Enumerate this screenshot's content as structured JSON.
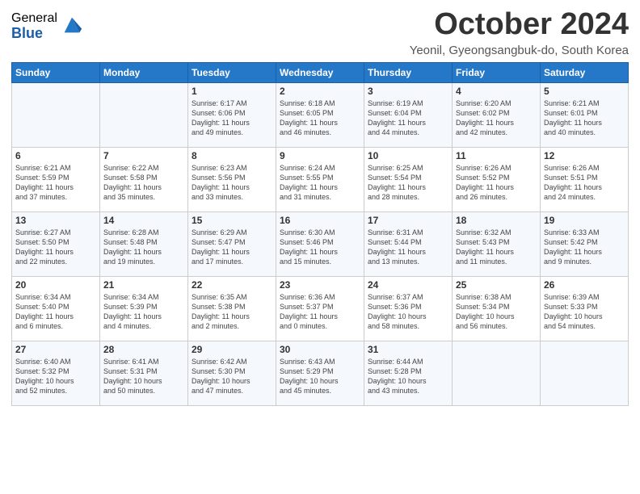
{
  "logo": {
    "general": "General",
    "blue": "Blue"
  },
  "title": "October 2024",
  "subtitle": "Yeonil, Gyeongsangbuk-do, South Korea",
  "days_of_week": [
    "Sunday",
    "Monday",
    "Tuesday",
    "Wednesday",
    "Thursday",
    "Friday",
    "Saturday"
  ],
  "weeks": [
    [
      {
        "num": "",
        "detail": ""
      },
      {
        "num": "",
        "detail": ""
      },
      {
        "num": "1",
        "detail": "Sunrise: 6:17 AM\nSunset: 6:06 PM\nDaylight: 11 hours\nand 49 minutes."
      },
      {
        "num": "2",
        "detail": "Sunrise: 6:18 AM\nSunset: 6:05 PM\nDaylight: 11 hours\nand 46 minutes."
      },
      {
        "num": "3",
        "detail": "Sunrise: 6:19 AM\nSunset: 6:04 PM\nDaylight: 11 hours\nand 44 minutes."
      },
      {
        "num": "4",
        "detail": "Sunrise: 6:20 AM\nSunset: 6:02 PM\nDaylight: 11 hours\nand 42 minutes."
      },
      {
        "num": "5",
        "detail": "Sunrise: 6:21 AM\nSunset: 6:01 PM\nDaylight: 11 hours\nand 40 minutes."
      }
    ],
    [
      {
        "num": "6",
        "detail": "Sunrise: 6:21 AM\nSunset: 5:59 PM\nDaylight: 11 hours\nand 37 minutes."
      },
      {
        "num": "7",
        "detail": "Sunrise: 6:22 AM\nSunset: 5:58 PM\nDaylight: 11 hours\nand 35 minutes."
      },
      {
        "num": "8",
        "detail": "Sunrise: 6:23 AM\nSunset: 5:56 PM\nDaylight: 11 hours\nand 33 minutes."
      },
      {
        "num": "9",
        "detail": "Sunrise: 6:24 AM\nSunset: 5:55 PM\nDaylight: 11 hours\nand 31 minutes."
      },
      {
        "num": "10",
        "detail": "Sunrise: 6:25 AM\nSunset: 5:54 PM\nDaylight: 11 hours\nand 28 minutes."
      },
      {
        "num": "11",
        "detail": "Sunrise: 6:26 AM\nSunset: 5:52 PM\nDaylight: 11 hours\nand 26 minutes."
      },
      {
        "num": "12",
        "detail": "Sunrise: 6:26 AM\nSunset: 5:51 PM\nDaylight: 11 hours\nand 24 minutes."
      }
    ],
    [
      {
        "num": "13",
        "detail": "Sunrise: 6:27 AM\nSunset: 5:50 PM\nDaylight: 11 hours\nand 22 minutes."
      },
      {
        "num": "14",
        "detail": "Sunrise: 6:28 AM\nSunset: 5:48 PM\nDaylight: 11 hours\nand 19 minutes."
      },
      {
        "num": "15",
        "detail": "Sunrise: 6:29 AM\nSunset: 5:47 PM\nDaylight: 11 hours\nand 17 minutes."
      },
      {
        "num": "16",
        "detail": "Sunrise: 6:30 AM\nSunset: 5:46 PM\nDaylight: 11 hours\nand 15 minutes."
      },
      {
        "num": "17",
        "detail": "Sunrise: 6:31 AM\nSunset: 5:44 PM\nDaylight: 11 hours\nand 13 minutes."
      },
      {
        "num": "18",
        "detail": "Sunrise: 6:32 AM\nSunset: 5:43 PM\nDaylight: 11 hours\nand 11 minutes."
      },
      {
        "num": "19",
        "detail": "Sunrise: 6:33 AM\nSunset: 5:42 PM\nDaylight: 11 hours\nand 9 minutes."
      }
    ],
    [
      {
        "num": "20",
        "detail": "Sunrise: 6:34 AM\nSunset: 5:40 PM\nDaylight: 11 hours\nand 6 minutes."
      },
      {
        "num": "21",
        "detail": "Sunrise: 6:34 AM\nSunset: 5:39 PM\nDaylight: 11 hours\nand 4 minutes."
      },
      {
        "num": "22",
        "detail": "Sunrise: 6:35 AM\nSunset: 5:38 PM\nDaylight: 11 hours\nand 2 minutes."
      },
      {
        "num": "23",
        "detail": "Sunrise: 6:36 AM\nSunset: 5:37 PM\nDaylight: 11 hours\nand 0 minutes."
      },
      {
        "num": "24",
        "detail": "Sunrise: 6:37 AM\nSunset: 5:36 PM\nDaylight: 10 hours\nand 58 minutes."
      },
      {
        "num": "25",
        "detail": "Sunrise: 6:38 AM\nSunset: 5:34 PM\nDaylight: 10 hours\nand 56 minutes."
      },
      {
        "num": "26",
        "detail": "Sunrise: 6:39 AM\nSunset: 5:33 PM\nDaylight: 10 hours\nand 54 minutes."
      }
    ],
    [
      {
        "num": "27",
        "detail": "Sunrise: 6:40 AM\nSunset: 5:32 PM\nDaylight: 10 hours\nand 52 minutes."
      },
      {
        "num": "28",
        "detail": "Sunrise: 6:41 AM\nSunset: 5:31 PM\nDaylight: 10 hours\nand 50 minutes."
      },
      {
        "num": "29",
        "detail": "Sunrise: 6:42 AM\nSunset: 5:30 PM\nDaylight: 10 hours\nand 47 minutes."
      },
      {
        "num": "30",
        "detail": "Sunrise: 6:43 AM\nSunset: 5:29 PM\nDaylight: 10 hours\nand 45 minutes."
      },
      {
        "num": "31",
        "detail": "Sunrise: 6:44 AM\nSunset: 5:28 PM\nDaylight: 10 hours\nand 43 minutes."
      },
      {
        "num": "",
        "detail": ""
      },
      {
        "num": "",
        "detail": ""
      }
    ]
  ]
}
